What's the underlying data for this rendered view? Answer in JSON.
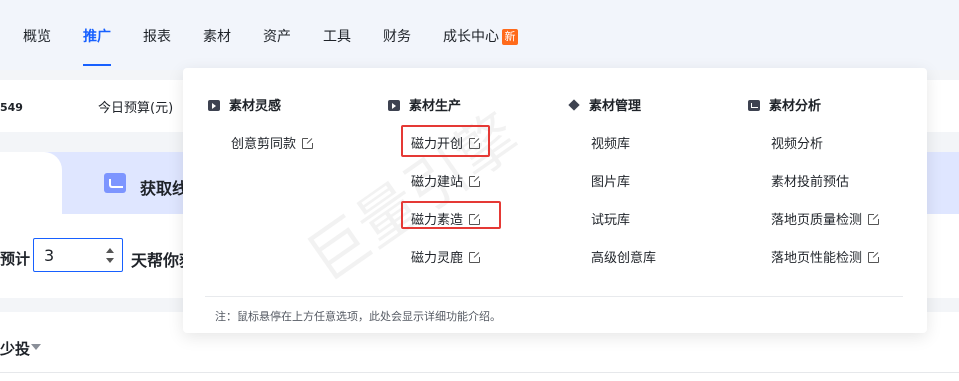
{
  "nav": {
    "items": [
      "概览",
      "推广",
      "报表",
      "素材",
      "资产",
      "工具",
      "财务",
      "成长中心"
    ],
    "active_index": 1,
    "new_badge": "新"
  },
  "stats": {
    "partial_number": "549",
    "today_budget_label": "今日预算(元)"
  },
  "banner": {
    "tab_partial_text": "获取线"
  },
  "predict": {
    "prefix_partial": "预计",
    "value": "3",
    "suffix_partial": "天帮你获"
  },
  "section2": {
    "partial_label": "少投"
  },
  "dropdown": {
    "columns": [
      {
        "title": "素材灵感",
        "icon": "play-icon",
        "items": [
          "创意剪同款"
        ]
      },
      {
        "title": "素材生产",
        "icon": "play-square-icon",
        "items": [
          "磁力开创",
          "磁力建站",
          "磁力素造",
          "磁力灵鹿"
        ]
      },
      {
        "title": "素材管理",
        "icon": "diamond-icon",
        "items": [
          "视频库",
          "图片库",
          "试玩库",
          "高级创意库"
        ]
      },
      {
        "title": "素材分析",
        "icon": "chart-icon",
        "items": [
          "视频分析",
          "素材投前预估",
          "落地页质量检测",
          "落地页性能检测"
        ]
      }
    ],
    "note": "注：鼠标悬停在上方任意选项，此处会显示详细功能介绍。"
  },
  "watermark": "巨量引擎",
  "colors": {
    "primary": "#1760ff",
    "badge": "#ff6a1b",
    "highlight": "#e53935"
  }
}
